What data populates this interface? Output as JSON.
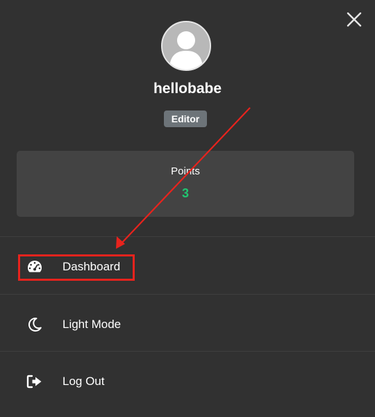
{
  "profile": {
    "username": "hellobabe",
    "role": "Editor"
  },
  "points": {
    "label": "Points",
    "value": "3"
  },
  "menu": {
    "items": [
      {
        "label": "Dashboard",
        "icon": "dashboard-gauge-icon"
      },
      {
        "label": "Light Mode",
        "icon": "moon-icon"
      },
      {
        "label": "Log Out",
        "icon": "logout-icon"
      }
    ]
  },
  "colors": {
    "background": "#313131",
    "card": "#434343",
    "badge": "#6d7479",
    "points_value": "#20c570",
    "annotation_red": "#e8231d"
  }
}
